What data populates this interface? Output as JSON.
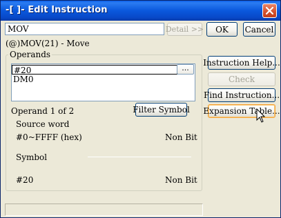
{
  "window": {
    "title": "-[ ]- Edit Instruction"
  },
  "instruction": {
    "value": "MOV",
    "detail_label": "Detail >>",
    "ok_label": "OK",
    "cancel_label": "Cancel",
    "description": "(@)MOV(21) - Move"
  },
  "operands": {
    "group_title": "Operands",
    "items": [
      "#20",
      "DM0"
    ],
    "browse_label": "...",
    "counter": "Operand 1 of 2",
    "filter_label": "Filter Symbol",
    "kind": "Source word",
    "range": "#0~FFFF (hex)",
    "type": "Non Bit",
    "symbol_label": "Symbol",
    "value": "#20",
    "value_type": "Non Bit"
  },
  "side_buttons": {
    "help": "Instruction Help...",
    "check": "Check",
    "find": "Find Instruction...",
    "expansion": "Expansion Table..."
  },
  "colors": {
    "titlebar": "#0a58dc",
    "face": "#ece9d8",
    "close": "#d4502c"
  },
  "icons": {
    "close": "close-icon",
    "cursor": "mouse-pointer-icon"
  }
}
